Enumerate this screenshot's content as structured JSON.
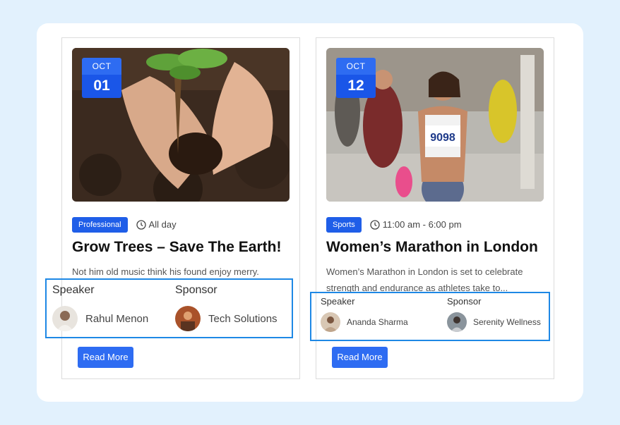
{
  "events": [
    {
      "month": "OCT",
      "day": "01",
      "category": "Professional",
      "time": "All day",
      "title": "Grow Trees – Save The Earth!",
      "description": "Not him old music think his found enjoy merry.",
      "speaker_label": "Speaker",
      "speaker_name": "Rahul Menon",
      "sponsor_label": "Sponsor",
      "sponsor_name": "Tech Solutions",
      "button": "Read More"
    },
    {
      "month": "OCT",
      "day": "12",
      "category": "Sports",
      "time": "11:00 am - 6:00 pm",
      "title": "Women’s Marathon in London",
      "description": "Women’s Marathon in London is set to celebrate strength and endurance as athletes take to...",
      "speaker_label": "Speaker",
      "speaker_name": "Ananda Sharma",
      "sponsor_label": "Sponsor",
      "sponsor_name": "Serenity Wellness",
      "button": "Read More"
    }
  ],
  "colors": {
    "background": "#e2f1fd",
    "accent": "#2e6cf2",
    "highlight_box": "#1e88e5"
  },
  "icons": {
    "time": "clock-icon"
  }
}
